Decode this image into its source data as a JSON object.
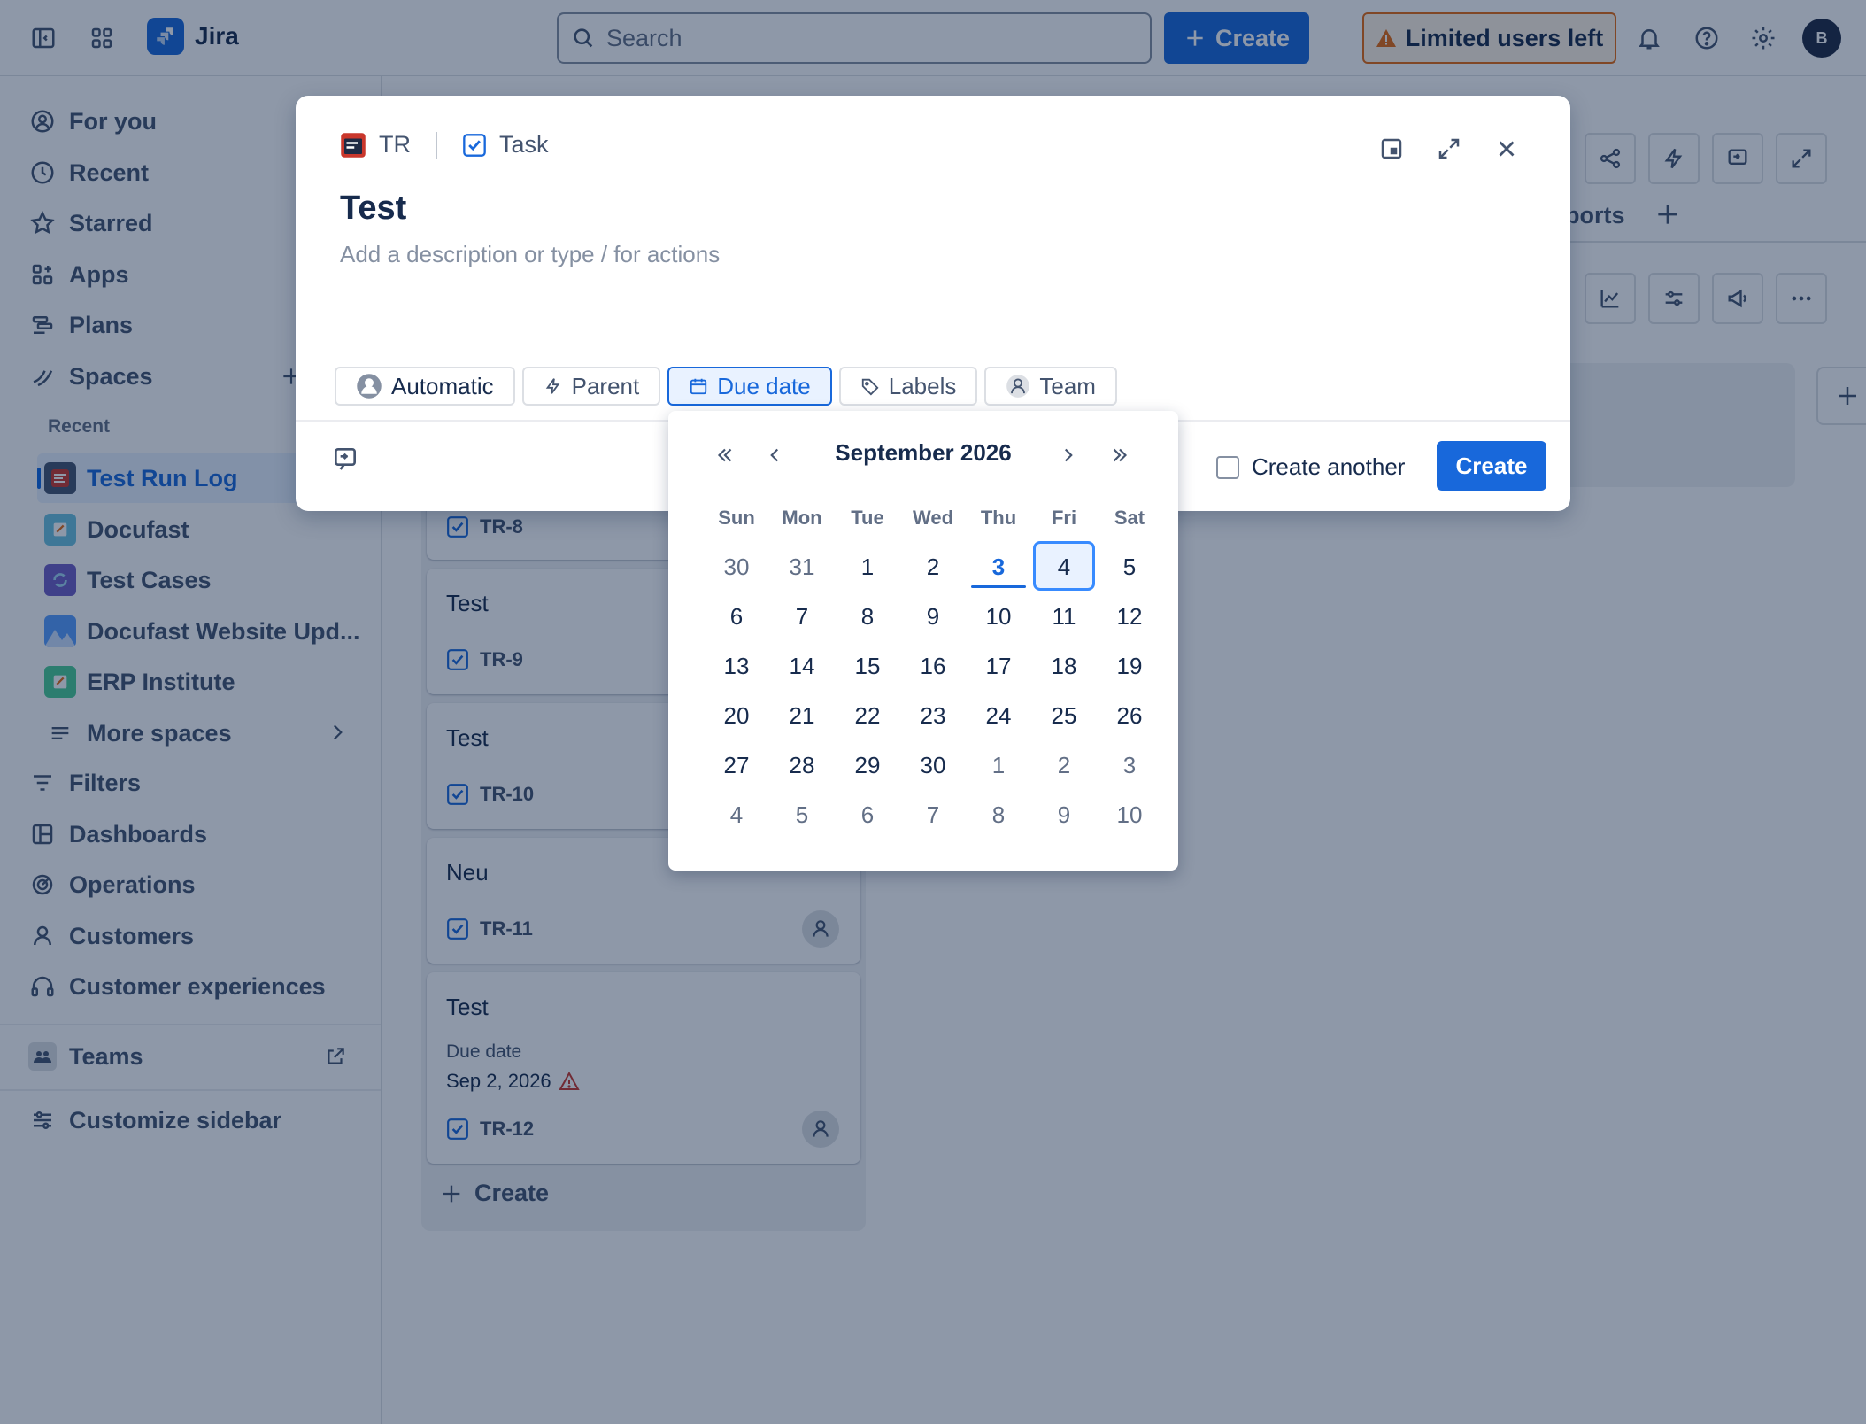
{
  "topbar": {
    "app_name": "Jira",
    "search_placeholder": "Search",
    "create_label": "Create",
    "limited_label": "Limited users left",
    "avatar_initial": "B"
  },
  "sidebar": {
    "nav": [
      "For you",
      "Recent",
      "Starred",
      "Apps",
      "Plans",
      "Spaces"
    ],
    "recent_label": "Recent",
    "spaces": [
      {
        "label": "Test Run Log",
        "color": "#c9372c"
      },
      {
        "label": "Docufast",
        "color": "#6cc3e0"
      },
      {
        "label": "Test Cases",
        "color": "#6e5dc6"
      },
      {
        "label": "Docufast Website Upd...",
        "color": "#579dff"
      },
      {
        "label": "ERP Institute",
        "color": "#4bce97"
      }
    ],
    "more_spaces": "More spaces",
    "bottom_nav": [
      "Filters",
      "Dashboards",
      "Operations",
      "Customers",
      "Customer experiences"
    ],
    "teams": "Teams",
    "customize": "Customize sidebar"
  },
  "board": {
    "tab_reports_partial": "ports",
    "cards": [
      {
        "key": "TR-8"
      },
      {
        "title": "Test",
        "key": "TR-9"
      },
      {
        "title": "Test",
        "key": "TR-10"
      },
      {
        "title": "Neu",
        "key": "TR-11"
      },
      {
        "title": "Test",
        "due_label": "Due date",
        "due_value": "Sep 2, 2026",
        "key": "TR-12"
      }
    ],
    "create_label": "Create"
  },
  "modal": {
    "project": "TR",
    "issue_type": "Task",
    "title": "Test",
    "description_placeholder": "Add a description or type / for actions",
    "chips": [
      "Automatic",
      "Parent",
      "Due date",
      "Labels",
      "Team"
    ],
    "create_another": "Create another",
    "create_button": "Create"
  },
  "calendar": {
    "month": "September 2026",
    "weekdays": [
      "Sun",
      "Mon",
      "Tue",
      "Wed",
      "Thu",
      "Fri",
      "Sat"
    ],
    "weeks": [
      [
        "30",
        "31",
        "1",
        "2",
        "3",
        "4",
        "5"
      ],
      [
        "6",
        "7",
        "8",
        "9",
        "10",
        "11",
        "12"
      ],
      [
        "13",
        "14",
        "15",
        "16",
        "17",
        "18",
        "19"
      ],
      [
        "20",
        "21",
        "22",
        "23",
        "24",
        "25",
        "26"
      ],
      [
        "27",
        "28",
        "29",
        "30",
        "1",
        "2",
        "3"
      ],
      [
        "4",
        "5",
        "6",
        "7",
        "8",
        "9",
        "10"
      ]
    ],
    "today": "3",
    "selected": "4"
  },
  "colors": {
    "brand": "#1868db",
    "warning": "#e56910",
    "danger": "#c9372c"
  }
}
